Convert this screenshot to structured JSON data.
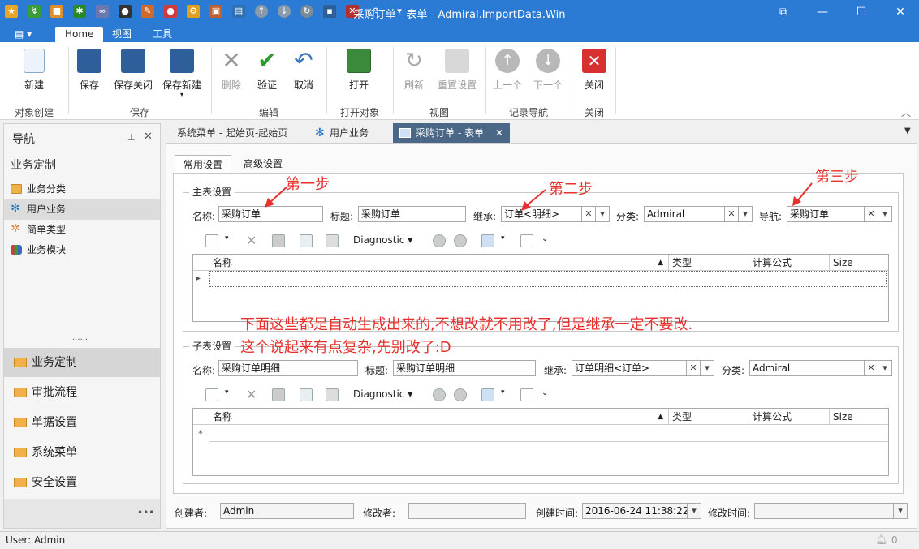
{
  "window": {
    "title": "采购订单 - 表单 - Admiral.ImportData.Win",
    "restore_glyph": "⧉",
    "minimize_glyph": "—",
    "maximize_glyph": "☐",
    "close_glyph": "✕"
  },
  "menu_tabs": [
    {
      "label": "Home"
    },
    {
      "label": "视图"
    },
    {
      "label": "工具"
    }
  ],
  "ribbon": {
    "buttons": [
      {
        "label": "新建"
      },
      {
        "label": "保存"
      },
      {
        "label": "保存关闭"
      },
      {
        "label": "保存新建"
      },
      {
        "label": "删除"
      },
      {
        "label": "验证"
      },
      {
        "label": "取消"
      },
      {
        "label": "打开"
      },
      {
        "label": "刷新"
      },
      {
        "label": "重置设置"
      },
      {
        "label": "上一个"
      },
      {
        "label": "下一个"
      },
      {
        "label": "关闭"
      }
    ],
    "groups": [
      "对象创建",
      "保存",
      "编辑",
      "打开对象",
      "视图",
      "记录导航",
      "关闭"
    ]
  },
  "nav": {
    "title": "导航",
    "section_title": "业务定制",
    "items": [
      {
        "label": "业务分类"
      },
      {
        "label": "用户业务"
      },
      {
        "label": "简单类型"
      },
      {
        "label": "业务模块"
      }
    ],
    "groups": [
      {
        "label": "业务定制"
      },
      {
        "label": "审批流程"
      },
      {
        "label": "单据设置"
      },
      {
        "label": "系统菜单"
      },
      {
        "label": "安全设置"
      }
    ],
    "more": "•••",
    "splitter": "......"
  },
  "doc_tabs": [
    {
      "label": "系统菜单 - 起始页-起始页"
    },
    {
      "label": "用户业务"
    },
    {
      "label": "采购订单 - 表单"
    }
  ],
  "form_tabs": [
    {
      "label": "常用设置"
    },
    {
      "label": "高级设置"
    }
  ],
  "master": {
    "section": "主表设置",
    "name_label": "名称:",
    "name_value": "采购订单",
    "title_label": "标题:",
    "title_value": "采购订单",
    "inherit_label": "继承:",
    "inherit_value": "订单<明细>",
    "category_label": "分类:",
    "category_value": "Admiral",
    "nav_label": "导航:",
    "nav_value": "采购订单",
    "toolbar_diag": "Diagnostic",
    "columns": [
      "名称",
      "类型",
      "计算公式",
      "Size"
    ],
    "row_marker": "▸"
  },
  "detail": {
    "section": "子表设置",
    "name_label": "名称:",
    "name_value": "采购订单明细",
    "title_label": "标题:",
    "title_value": "采购订单明细",
    "inherit_label": "继承:",
    "inherit_value": "订单明细<订单>",
    "category_label": "分类:",
    "category_value": "Admiral",
    "toolbar_diag": "Diagnostic",
    "columns": [
      "名称",
      "类型",
      "计算公式",
      "Size"
    ],
    "row_marker": "*"
  },
  "annotations": {
    "step1": "第一步",
    "step2": "第二步",
    "step3": "第三步",
    "note1": "下面这些都是自动生成出来的,不想改就不用改了,但是继承一定不要改.",
    "note2": "这个说起来有点复杂,先别改了:D"
  },
  "footer": {
    "creator_label": "创建者:",
    "creator_value": "Admin",
    "modifier_label": "修改者:",
    "modifier_value": "",
    "created_label": "创建时间:",
    "created_value": "2016-06-24 11:38:22",
    "modified_label": "修改时间:",
    "modified_value": ""
  },
  "status": {
    "user": "User: Admin",
    "notifications": "0"
  },
  "colors": {
    "accent": "#2b7bd4",
    "annotation": "#e8302c",
    "active_doc_tab": "#4a6787"
  }
}
